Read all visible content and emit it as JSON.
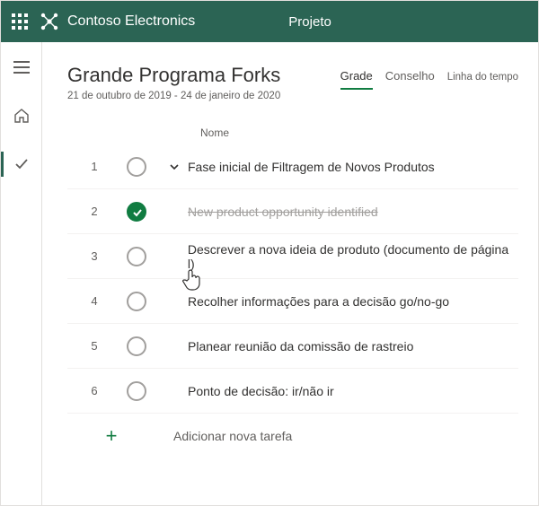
{
  "header": {
    "org_name": "Contoso Electronics",
    "app_name": "Projeto"
  },
  "project": {
    "title": "Grande  Programa Forks",
    "date_range": "21 de outubro de 2019 - 24 de janeiro de 2020"
  },
  "tabs": {
    "grid": "Grade",
    "board": "Conselho",
    "timeline": "Linha do tempo"
  },
  "columns": {
    "name": "Nome"
  },
  "tasks": [
    {
      "num": "1",
      "name": "Fase inicial de Filtragem de Novos Produtos",
      "summary": true,
      "completed": false,
      "expanded": true
    },
    {
      "num": "2",
      "name": "New product opportunity identified",
      "summary": false,
      "completed": true
    },
    {
      "num": "3",
      "name": "Descrever a nova ideia de produto (documento de página l)",
      "summary": false,
      "completed": false
    },
    {
      "num": "4",
      "name": "Recolher informações para a decisão go/no-go",
      "summary": false,
      "completed": false
    },
    {
      "num": "5",
      "name": "Planear reunião da comissão de rastreio",
      "summary": false,
      "completed": false
    },
    {
      "num": "6",
      "name": "Ponto de decisão: ir/não ir",
      "summary": false,
      "completed": false
    }
  ],
  "add_task_label": "Adicionar nova tarefa"
}
